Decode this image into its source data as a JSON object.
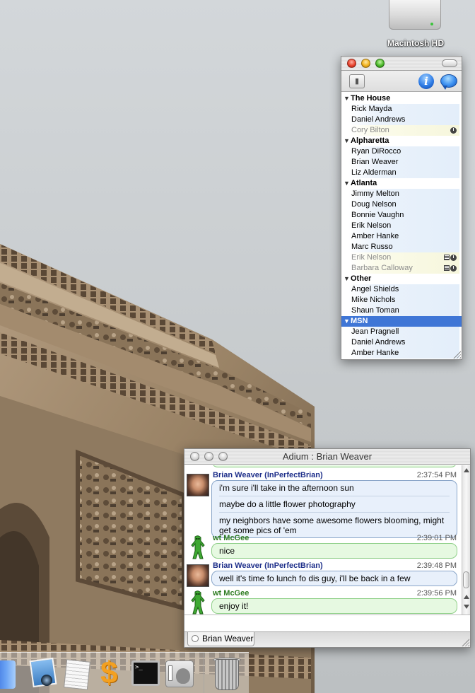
{
  "desktop": {
    "drive_label": "Macintosh HD"
  },
  "contact_list": {
    "groups": [
      {
        "name": "The House",
        "contacts": [
          {
            "name": "Rick Mayda",
            "idle": false
          },
          {
            "name": "Daniel Andrews",
            "idle": false
          },
          {
            "name": "Cory Bilton",
            "idle": true,
            "icons": [
              "clock-icon"
            ]
          }
        ]
      },
      {
        "name": "Alpharetta",
        "contacts": [
          {
            "name": "Ryan DiRocco",
            "idle": false
          },
          {
            "name": "Brian Weaver",
            "idle": false
          },
          {
            "name": "Liz Alderman",
            "idle": false
          }
        ]
      },
      {
        "name": "Atlanta",
        "contacts": [
          {
            "name": "Jimmy Melton",
            "idle": false
          },
          {
            "name": "Doug Nelson",
            "idle": false
          },
          {
            "name": "Bonnie Vaughn",
            "idle": false
          },
          {
            "name": "Erik Nelson",
            "idle": false
          },
          {
            "name": "Amber Hanke",
            "idle": false
          },
          {
            "name": "Marc Russo",
            "idle": false
          },
          {
            "name": "Erik Nelson",
            "idle": true,
            "icons": [
              "note-icon",
              "clock-icon"
            ]
          },
          {
            "name": "Barbara Calloway",
            "idle": true,
            "icons": [
              "note-icon",
              "clock-icon"
            ]
          }
        ]
      },
      {
        "name": "Other",
        "contacts": [
          {
            "name": "Angel Shields",
            "idle": false
          },
          {
            "name": "Mike Nichols",
            "idle": false
          },
          {
            "name": "Shaun Toman",
            "idle": false
          }
        ]
      },
      {
        "name": "MSN",
        "selected": true,
        "contacts": [
          {
            "name": "Jean Pragnell",
            "idle": false
          },
          {
            "name": "Daniel Andrews",
            "idle": false
          },
          {
            "name": "Amber Hanke",
            "idle": false
          }
        ]
      }
    ]
  },
  "chat": {
    "window_title": "Adium : Brian Weaver",
    "tab_label": "Brian Weaver",
    "messages": [
      {
        "sender": "Brian Weaver (InPerfectBrian)",
        "time": "2:37:54 PM",
        "from": "brian",
        "lines": [
          "i'm sure i'll take in the afternoon sun",
          "maybe do a little flower photography",
          "my neighbors have some awesome flowers blooming, might get some pics of 'em"
        ]
      },
      {
        "sender": "wt McGee",
        "time": "2:39:01 PM",
        "from": "wt",
        "lines": [
          "nice"
        ]
      },
      {
        "sender": "Brian Weaver (InPerfectBrian)",
        "time": "2:39:48 PM",
        "from": "brian",
        "lines": [
          "well it's time fo lunch fo dis guy, i'll be back in a few"
        ]
      },
      {
        "sender": "wt McGee",
        "time": "2:39:56 PM",
        "from": "wt",
        "lines": [
          "enjoy it!"
        ]
      }
    ]
  },
  "colors": {
    "selected_group": "#3f76d6",
    "brian_name": "#1e2f8a",
    "wt_name": "#2b7a1e",
    "brian_bubble": "#e8f0fb",
    "wt_bubble": "#e6f9e1"
  },
  "dock": {
    "items": [
      "finder-icon",
      "iphoto-icon",
      "textedit-icon",
      "adium-icon",
      "terminal-icon",
      "system-preferences-icon",
      "trash-icon"
    ]
  }
}
